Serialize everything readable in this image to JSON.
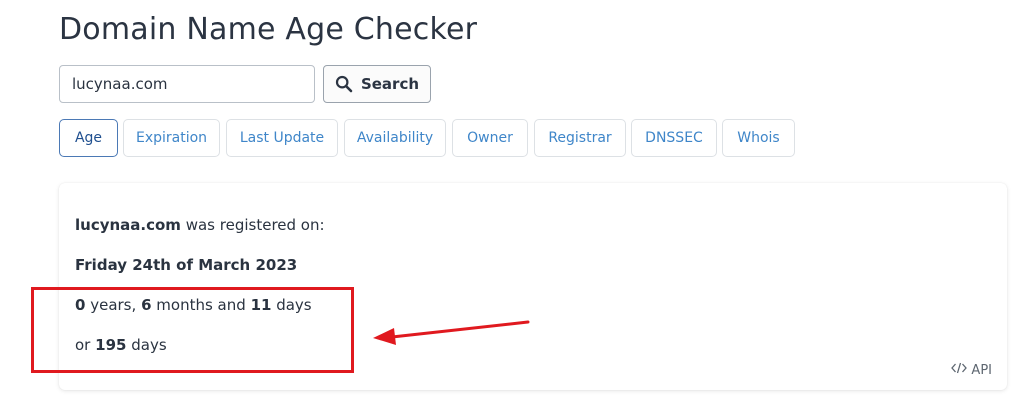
{
  "page": {
    "title": "Domain Name Age Checker"
  },
  "search": {
    "value": "lucynaa.com",
    "button_label": "Search",
    "icon": "search-icon"
  },
  "tabs": [
    {
      "label": "Age",
      "active": true
    },
    {
      "label": "Expiration",
      "active": false
    },
    {
      "label": "Last Update",
      "active": false
    },
    {
      "label": "Availability",
      "active": false
    },
    {
      "label": "Owner",
      "active": false
    },
    {
      "label": "Registrar",
      "active": false
    },
    {
      "label": "DNSSEC",
      "active": false
    },
    {
      "label": "Whois",
      "active": false
    }
  ],
  "result": {
    "domain": "lucynaa.com",
    "registered_text": "was registered on:",
    "date": "Friday 24th of March 2023",
    "years": "0",
    "years_label": "years,",
    "months": "6",
    "months_label": "months and",
    "days": "11",
    "days_label": "days",
    "total_prefix": "or",
    "total_days": "195",
    "total_suffix": "days"
  },
  "api": {
    "icon": "code-icon",
    "label": "API"
  },
  "annotation": {
    "highlight_color": "#e0191f",
    "arrow_color": "#e0191f"
  }
}
